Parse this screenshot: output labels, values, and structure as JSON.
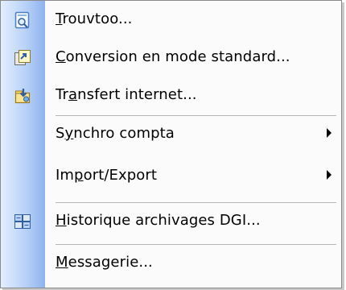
{
  "menu": {
    "items": [
      {
        "label": "Trouvtoo...",
        "accel": "T",
        "icon": "search-document-icon",
        "submenu": false
      },
      {
        "label": "Conversion en mode standard...",
        "accel": "C",
        "icon": "convert-icon",
        "submenu": false
      },
      {
        "label": "Transfert internet...",
        "accel": "a",
        "icon": "internet-transfer-icon",
        "submenu": false
      },
      {
        "label": "Synchro compta",
        "accel": "y",
        "icon": "",
        "submenu": true
      },
      {
        "label": "Import/Export",
        "accel": "p",
        "icon": "",
        "submenu": true
      },
      {
        "label": "Historique archivages DGI...",
        "accel": "H",
        "icon": "archive-history-icon",
        "submenu": false
      },
      {
        "label": "Messagerie...",
        "accel": "M",
        "icon": "",
        "submenu": false
      }
    ]
  },
  "colors": {
    "gutter_light": "#e3eefe",
    "gutter_dark": "#8fb2ee",
    "menu_background": "#fbfbfb",
    "border": "#8a8a8a"
  }
}
